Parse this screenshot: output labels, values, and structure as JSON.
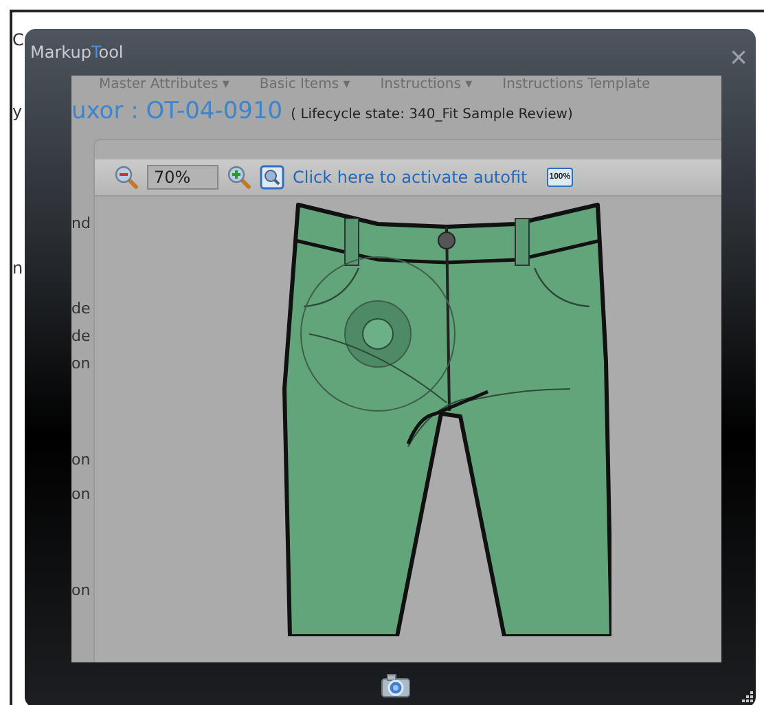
{
  "background_page": {
    "left_fragments": [
      "C",
      "y",
      "n"
    ],
    "nav_tabs": [
      {
        "label": "Master Attributes ▾"
      },
      {
        "label": "Basic Items ▾"
      },
      {
        "label": "Instructions ▾"
      },
      {
        "label": "Instructions Template"
      }
    ],
    "heading": "uxor : OT-04-0910",
    "lifecycle": "( Lifecycle state: 340_Fit Sample Review)",
    "row_fragments": [
      "nd",
      "de",
      "de",
      "on",
      "on",
      "on",
      "on"
    ]
  },
  "window": {
    "title_parts": [
      {
        "text": "Markup",
        "accent": false
      },
      {
        "text": "T",
        "accent": true
      },
      {
        "text": "ool",
        "accent": false
      }
    ],
    "close": "×"
  },
  "viewer": {
    "zoom_value": "70%",
    "autofit_link": "Click here to activate autofit",
    "actual_size": "100%"
  }
}
